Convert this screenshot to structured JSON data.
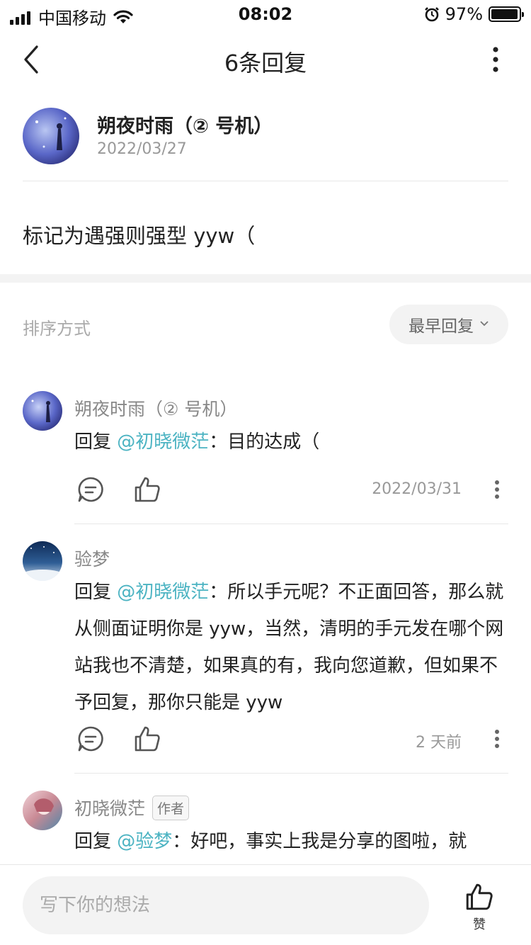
{
  "status_bar": {
    "carrier": "中国移动",
    "time": "08:02",
    "battery": "97%",
    "battery_level": 0.97
  },
  "nav": {
    "title": "6条回复"
  },
  "post": {
    "author": "朔夜时雨（② 号机）",
    "date": "2022/03/27",
    "body": "标记为遇强则强型 yyw（"
  },
  "sort": {
    "label": "排序方式",
    "selected": "最早回复"
  },
  "comments": [
    {
      "name": "朔夜时雨（② 号机）",
      "prefix": "回复 ",
      "mention": "@初晓微茫",
      "text": "：目的达成（",
      "time": "2022/03/31"
    },
    {
      "name": "验梦",
      "prefix": "回复 ",
      "mention": "@初晓微茫",
      "text": "：所以手元呢？不正面回答，那么就从侧面证明你是 yyw，当然，清明的手元发在哪个网站我也不清楚，如果真的有，我向您道歉，但如果不予回复，那你只能是 yyw",
      "time": "2 天前"
    },
    {
      "name": "初晓微茫",
      "badge": "作者",
      "prefix": "回复 ",
      "mention": "@验梦",
      "text": "：好吧，事实上我是分享的图啦，就"
    }
  ],
  "bottom": {
    "placeholder": "写下你的想法",
    "like_label": "赞"
  }
}
